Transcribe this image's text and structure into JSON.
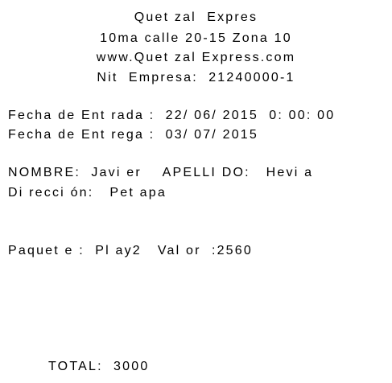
{
  "header": {
    "company_name": "Quet zal  Expres",
    "address": "10ma calle 20-15 Zona 10",
    "website": "www.Quet zal Express.com",
    "tax_id": "Nit  Empresa:  21240000-1"
  },
  "dates": {
    "entry": "Fecha de Ent rada :  22/ 06/ 2015  0: 00: 00",
    "delivery": "Fecha de Ent rega :  03/ 07/ 2015"
  },
  "customer": {
    "name_line": "NOMBRE:  Javi er    APELLI DO:   Hevi a",
    "address_line": "Di recci ón:   Pet apa"
  },
  "package": {
    "line": "Paquet e :  Pl ay2   Val or  :2560"
  },
  "totals": {
    "total_line": "TOTAL:  3000"
  }
}
